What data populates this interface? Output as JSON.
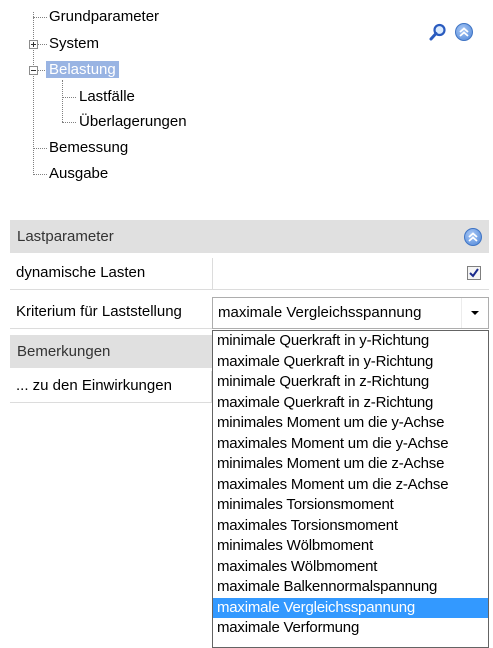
{
  "tree": {
    "items": [
      {
        "label": "Grundparameter"
      },
      {
        "label": "System"
      },
      {
        "label": "Belastung"
      },
      {
        "label": "Lastfälle"
      },
      {
        "label": "Überlagerungen"
      },
      {
        "label": "Bemessung"
      },
      {
        "label": "Ausgabe"
      }
    ],
    "selected": "Belastung"
  },
  "toolbar": {
    "search_icon": "magnifier-icon",
    "collapse_icon": "chevron-up-circle-icon"
  },
  "grid": {
    "category_1": "Lastparameter",
    "prop_dynamic": {
      "name": "dynamische Lasten",
      "checked": true
    },
    "prop_kriterium": {
      "name": "Kriterium für Laststellung",
      "value": "maximale Vergleichsspannung"
    },
    "category_2": "Bemerkungen",
    "prop_einwirkungen": {
      "name": "... zu den Einwirkungen"
    }
  },
  "dropdown": {
    "options": [
      "minimale Querkraft in y-Richtung",
      "maximale Querkraft in y-Richtung",
      "minimale Querkraft in z-Richtung",
      "maximale Querkraft in z-Richtung",
      "minimales Moment um die y-Achse",
      "maximales Moment um die y-Achse",
      "minimales Moment um die z-Achse",
      "maximales Moment um die z-Achse",
      "minimales Torsionsmoment",
      "maximales Torsionsmoment",
      "minimales Wölbmoment",
      "maximales Wölbmoment",
      "maximale Balkennormalspannung",
      "maximale Vergleichsspannung",
      "maximale Verformung"
    ],
    "selected_index": 13
  },
  "colors": {
    "selection": "#3399ff",
    "tree_selection": "#99b4e3",
    "category_bg": "#e0e0e0"
  }
}
